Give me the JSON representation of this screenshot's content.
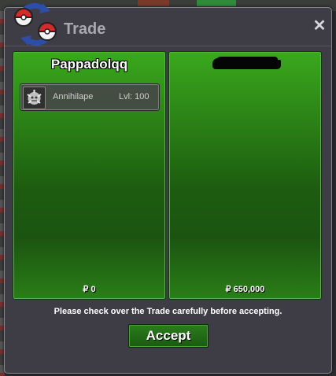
{
  "window": {
    "title": "Trade",
    "close_symbol": "✕"
  },
  "left_panel": {
    "player_name": "Pappadolqq",
    "monster": {
      "icon": "annihilape-sprite-icon",
      "name": "Annihilape",
      "level": "Lvl: 100"
    },
    "money": "₽ 0"
  },
  "right_panel": {
    "player_name_redacted": true,
    "money": "₽ 650,000"
  },
  "notice": "Please check over the Trade carefully before accepting.",
  "accept_label": "Accept",
  "colors": {
    "panel_green": "#2e8a17",
    "window_bg": "#3e3c45",
    "title_text": "#a9a7b0"
  }
}
